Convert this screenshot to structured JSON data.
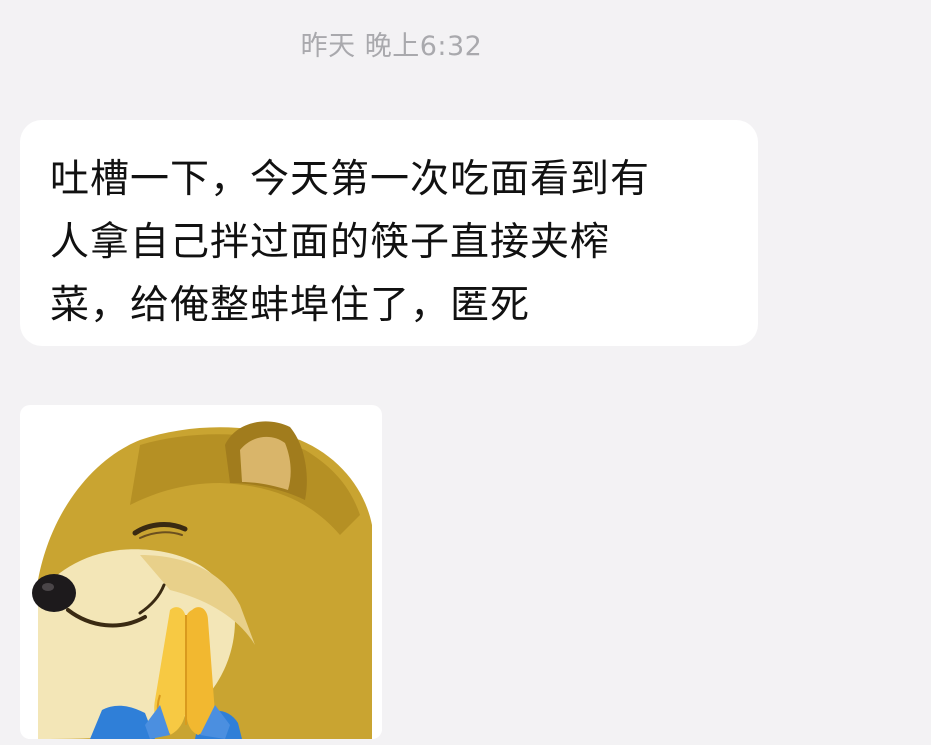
{
  "timestamp": "昨天 晚上6:32",
  "messages": [
    {
      "type": "text",
      "text": "吐槽一下，今天第一次吃面看到有\n人拿自己拌过面的筷子直接夹榨\n菜，给俺整蚌埠住了，匿死"
    },
    {
      "type": "sticker",
      "sticker_name": "shiba-praying-sticker"
    }
  ],
  "colors": {
    "background": "#f3f2f4",
    "bubble": "#ffffff",
    "timestamp_text": "#a9a9ad",
    "message_text": "#111111"
  }
}
